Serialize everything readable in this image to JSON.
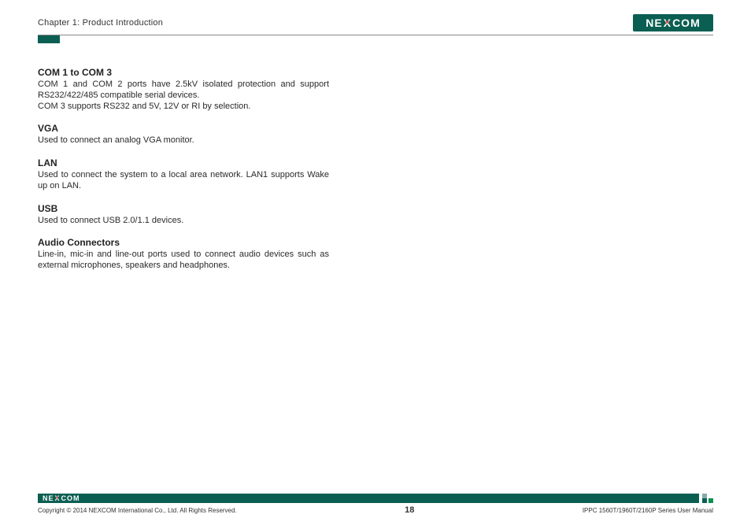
{
  "header": {
    "chapter": "Chapter 1: Product Introduction",
    "logo_text": "NE COM",
    "logo_x": "X"
  },
  "sections": [
    {
      "heading": "COM 1 to COM 3",
      "body": "COM 1 and COM 2 ports have 2.5kV isolated protection and support RS232/422/485 compatible serial devices.\nCOM 3 supports RS232 and 5V, 12V or RI by selection.",
      "justify": true
    },
    {
      "heading": "VGA",
      "body": "Used to connect an analog VGA monitor.",
      "justify": false
    },
    {
      "heading": "LAN",
      "body": "Used to connect the system to a local area network. LAN1 supports Wake up on LAN.",
      "justify": true
    },
    {
      "heading": "USB",
      "body": "Used to connect USB 2.0/1.1 devices.",
      "justify": false
    },
    {
      "heading": "Audio Connectors",
      "body": "Line-in, mic-in and line-out ports used to connect audio devices such as external microphones, speakers and headphones.",
      "justify": true
    }
  ],
  "footer": {
    "copyright": "Copyright © 2014 NEXCOM International Co., Ltd. All Rights Reserved.",
    "page": "18",
    "manual": "IPPC 1560T/1960T/2160P Series User Manual"
  }
}
